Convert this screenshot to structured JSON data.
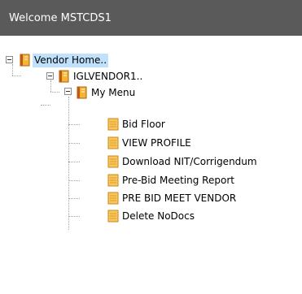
{
  "header": {
    "title": "Welcome MSTCDS1"
  },
  "tree": {
    "root_label": "Vendor Home..",
    "vendor_label": "IGLVENDOR1..",
    "menu_label": "My Menu",
    "items": [
      {
        "label": "Bid Floor"
      },
      {
        "label": "VIEW PROFILE"
      },
      {
        "label": "Download NIT/Corrigendum"
      },
      {
        "label": "Pre-Bid Meeting Report"
      },
      {
        "label": "PRE BID MEET VENDOR"
      },
      {
        "label": "Delete NoDocs"
      }
    ]
  },
  "icons": {
    "expand": "minus-box-icon",
    "folder": "book-folder-icon",
    "page": "document-icon"
  },
  "colors": {
    "header_bg": "#5a5a5a",
    "selected_bg": "#bfe1fb",
    "book": "#f0a022",
    "book_spine": "#c05a10",
    "doc": "#f7c65c"
  }
}
